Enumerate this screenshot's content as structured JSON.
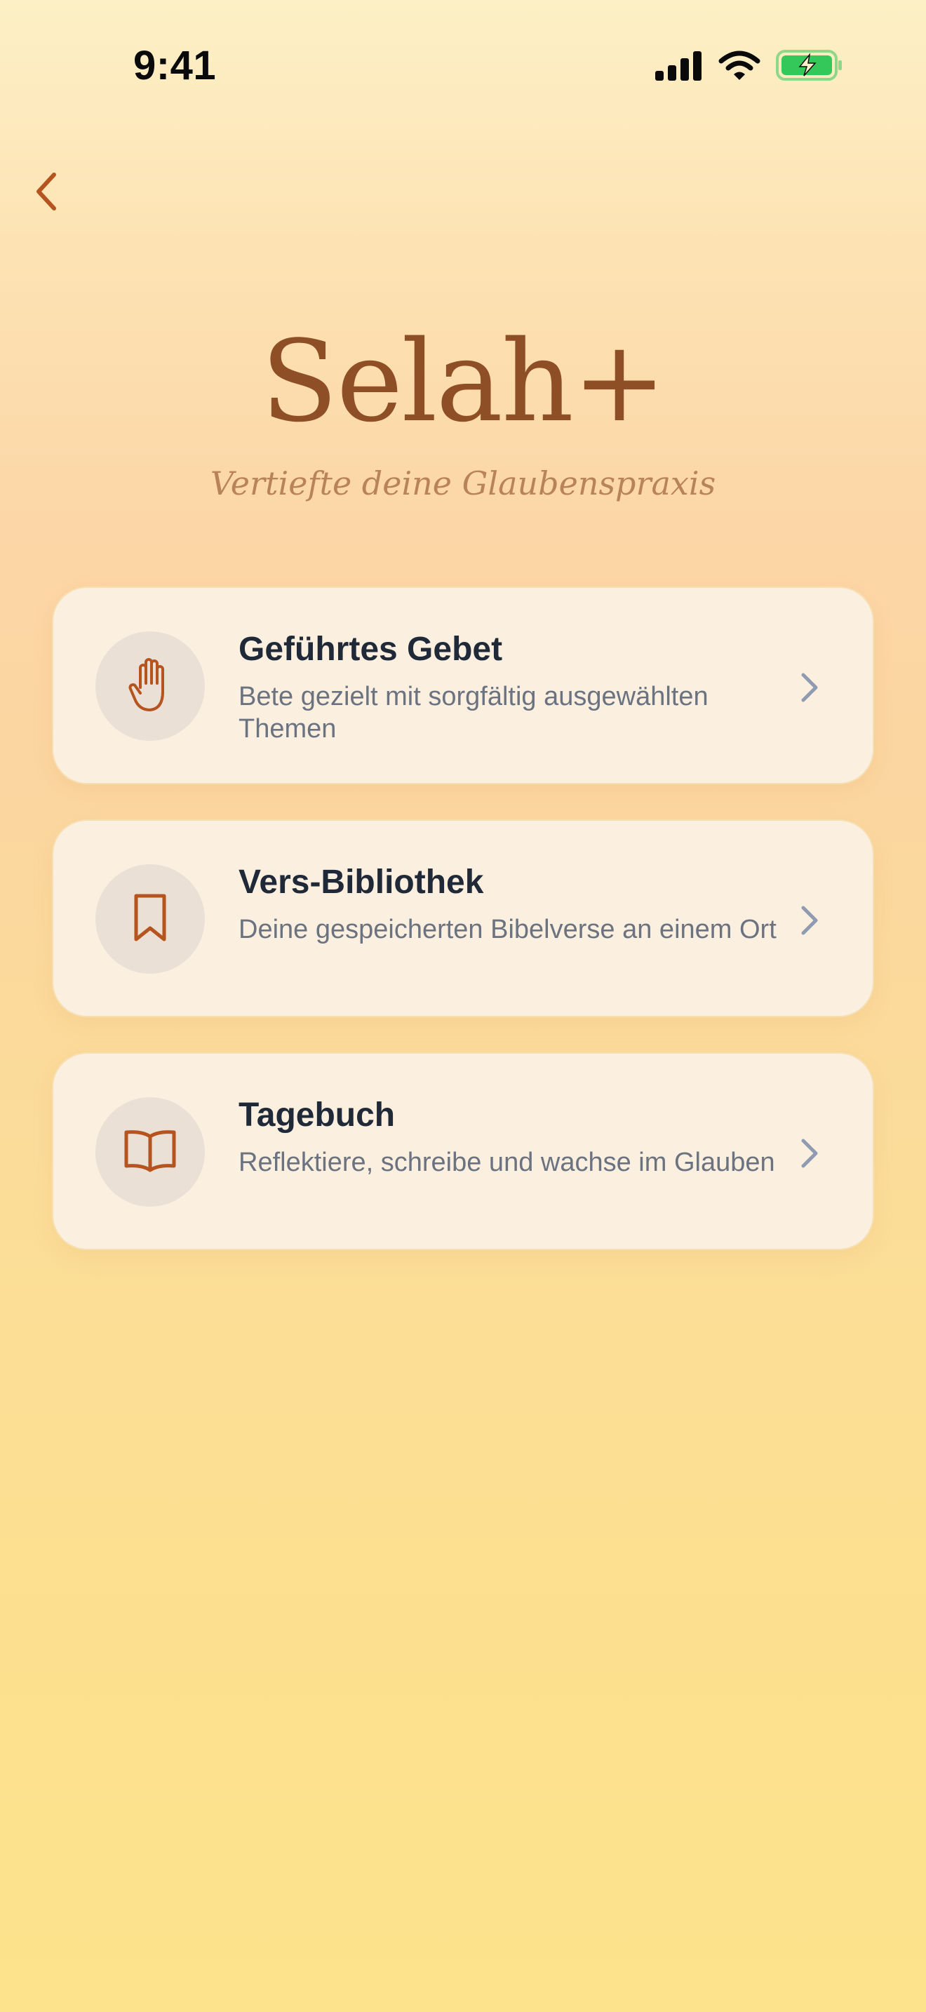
{
  "status_bar": {
    "time": "9:41",
    "icons": [
      "cellular-signal-icon",
      "wifi-icon",
      "battery-charging-icon"
    ],
    "battery_color": "#34c759"
  },
  "nav": {
    "back_icon": "chevron-left-icon",
    "accent": "#b5541e"
  },
  "header": {
    "title": "Selah+",
    "subtitle": "Vertiefte deine Glaubenspraxis"
  },
  "menu": {
    "items": [
      {
        "icon": "hand-icon",
        "title": "Geführtes Gebet",
        "description": "Bete gezielt mit sorgfältig ausgewählten Themen"
      },
      {
        "icon": "bookmark-icon",
        "title": "Vers-Bibliothek",
        "description": "Deine gespeicherten Bibelverse an einem Ort"
      },
      {
        "icon": "open-book-icon",
        "title": "Tagebuch",
        "description": "Reflektiere, schreibe und wachse im Glauben"
      }
    ]
  },
  "colors": {
    "title": "#8f4f26",
    "subtitle": "#b8835a",
    "icon": "#b5541e",
    "card_bg": "#fbefe0",
    "chevron": "#8f9bb0"
  }
}
